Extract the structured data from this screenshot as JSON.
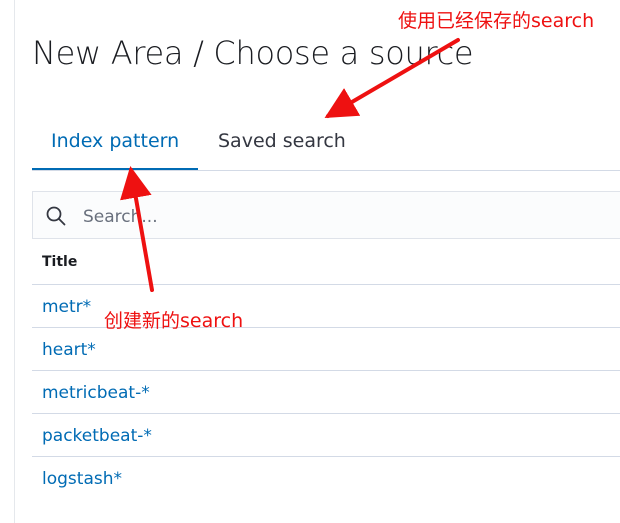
{
  "header": {
    "title": "New Area / Choose a source"
  },
  "tabs": [
    {
      "label": "Index pattern",
      "active": true
    },
    {
      "label": "Saved search",
      "active": false
    }
  ],
  "search": {
    "placeholder": "Search...",
    "value": "",
    "icon": "search-icon"
  },
  "table": {
    "column_title": "Title",
    "rows": [
      "metr*",
      "heart*",
      "metricbeat-*",
      "packetbeat-*",
      "logstash*"
    ]
  },
  "annotations": {
    "saved_search_note": "使用已经保存的search",
    "new_search_note": "创建新的search",
    "color": "#ee1111"
  },
  "colors": {
    "accent": "#006bb4",
    "text": "#1a1c21",
    "border": "#d3dae6"
  }
}
